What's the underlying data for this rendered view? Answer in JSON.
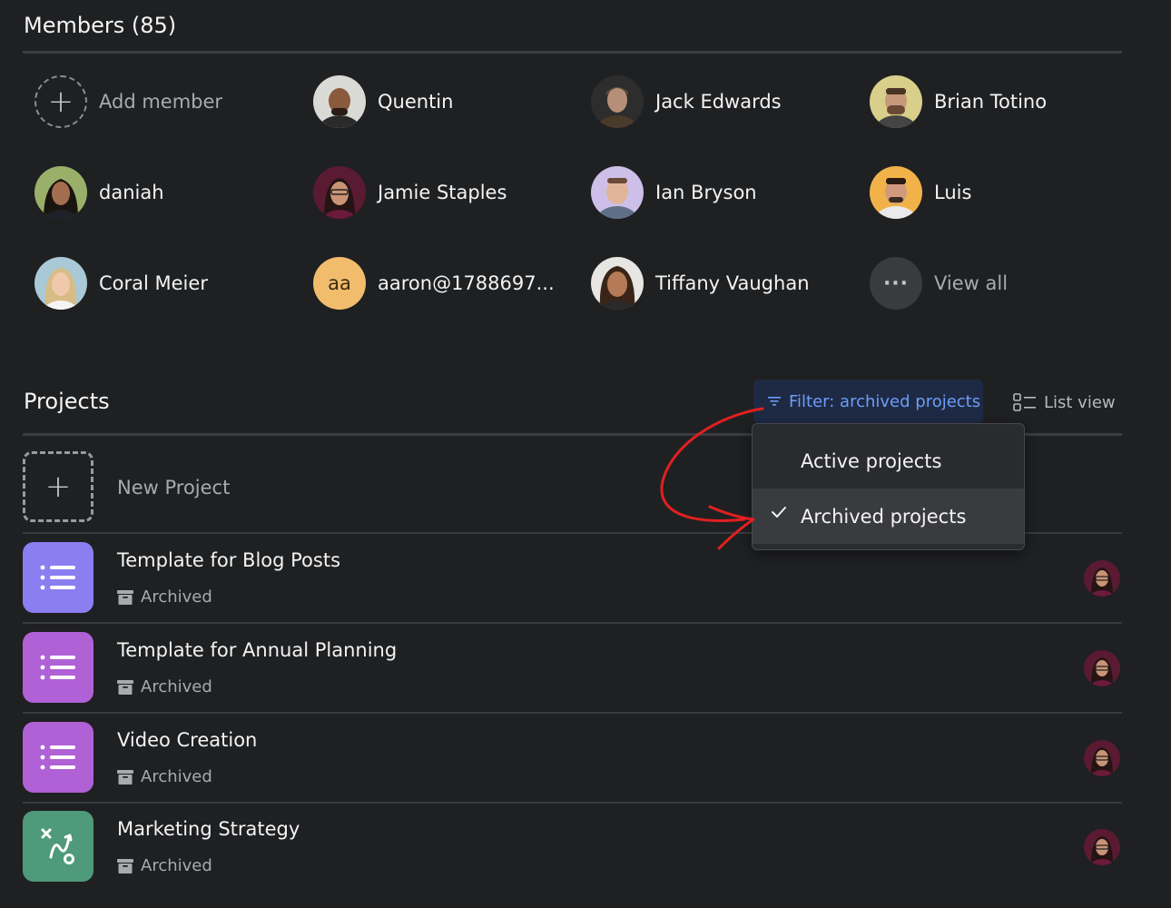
{
  "members": {
    "title": "Members (85)",
    "add_label": "Add member",
    "view_all_label": "View all",
    "people": [
      {
        "name": "Quentin"
      },
      {
        "name": "Jack Edwards"
      },
      {
        "name": "Brian Totino"
      },
      {
        "name": "daniah"
      },
      {
        "name": "Jamie Staples"
      },
      {
        "name": "Ian Bryson"
      },
      {
        "name": "Luis"
      },
      {
        "name": "Coral Meier"
      },
      {
        "name": "aaron@1788697...",
        "initials": "aa",
        "color": "#f1bd6c"
      },
      {
        "name": "Tiffany Vaughan"
      }
    ]
  },
  "projects": {
    "title": "Projects",
    "filter_label": "Filter: archived projects",
    "list_view_label": "List view",
    "new_project_label": "New Project",
    "items": [
      {
        "name": "Template for Blog Posts",
        "status": "Archived",
        "icon": "list-icon",
        "color": "#8a7ef0"
      },
      {
        "name": "Template for Annual Planning",
        "status": "Archived",
        "icon": "list-icon",
        "color": "#b061d6"
      },
      {
        "name": "Video Creation",
        "status": "Archived",
        "icon": "list-icon",
        "color": "#b061d6"
      },
      {
        "name": "Marketing Strategy",
        "status": "Archived",
        "icon": "strategy-icon",
        "color": "#4e9a7a"
      }
    ]
  },
  "dropdown": {
    "options": [
      {
        "label": "Active projects",
        "selected": false
      },
      {
        "label": "Archived projects",
        "selected": true
      }
    ]
  },
  "colors": {
    "background": "#1f2022",
    "accent": "#6e9cf7",
    "annotation": "#e02020"
  }
}
